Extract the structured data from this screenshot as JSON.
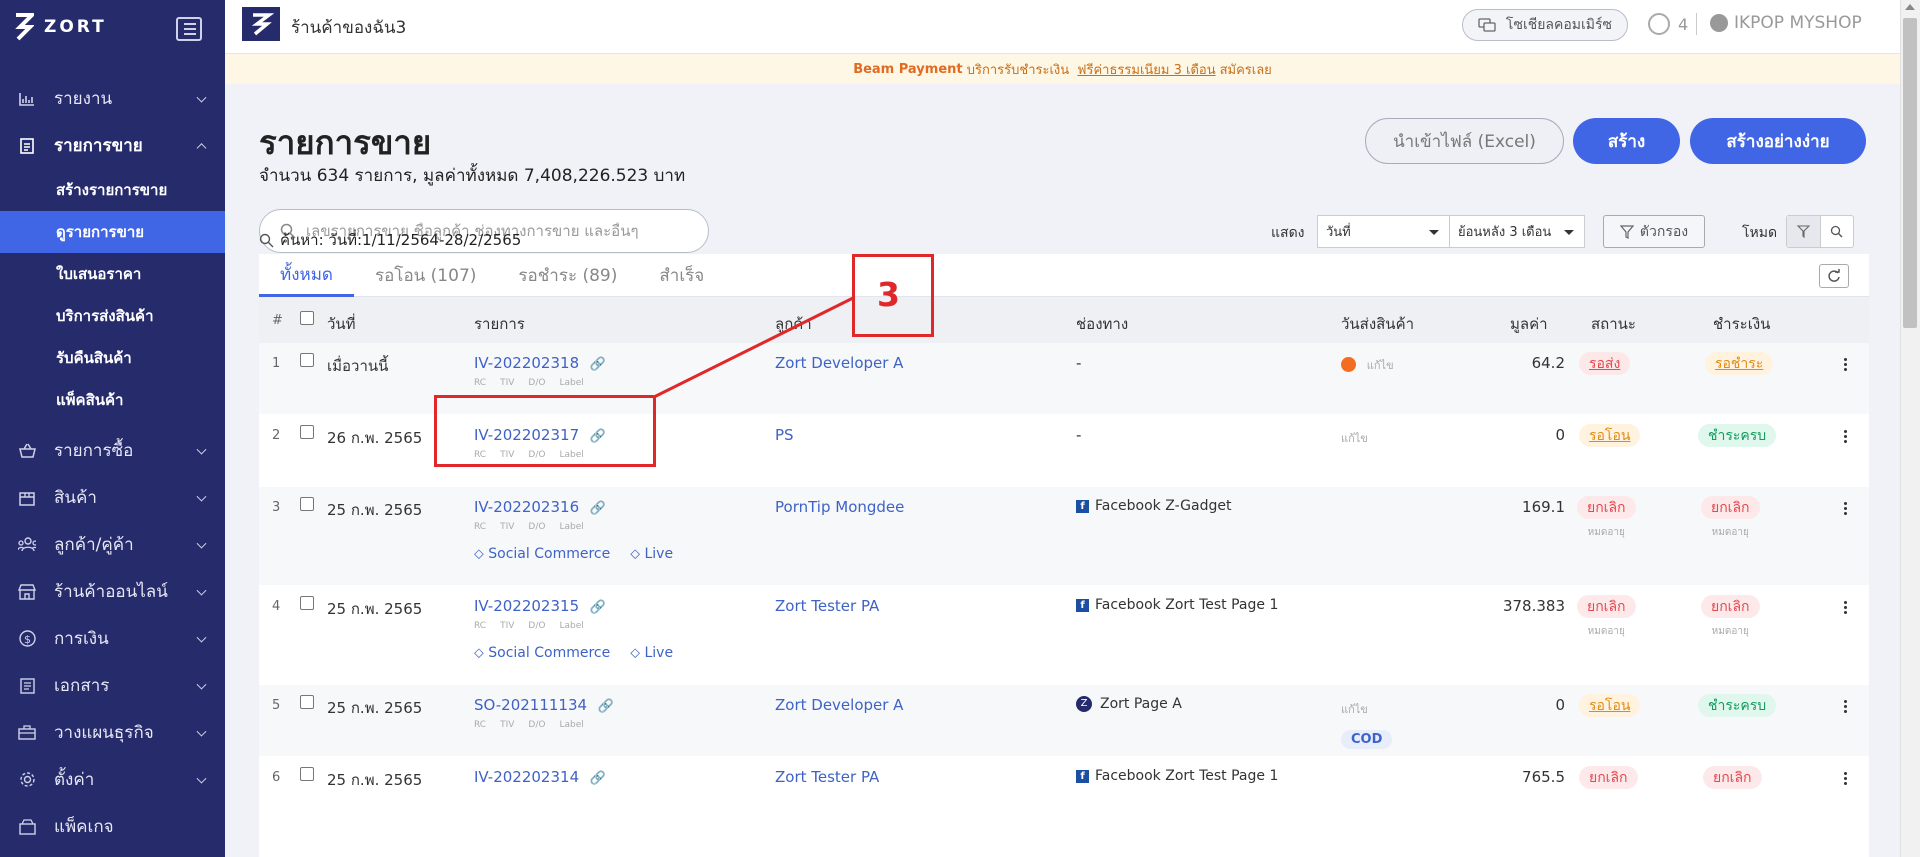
{
  "app": {
    "name": "ZORT",
    "store_name": "ร้านค้าของฉัน3",
    "social_btn": "โซเชียลคอมเมิร์ซ",
    "help_count": "4",
    "user": "IKPOP MYSHOP"
  },
  "sidebar": {
    "items": [
      {
        "label": "รายงาน",
        "icon": "chart-icon"
      },
      {
        "label": "รายการขาย",
        "icon": "clipboard-icon"
      },
      {
        "label": "รายการซื้อ",
        "icon": "basket-icon"
      },
      {
        "label": "สินค้า",
        "icon": "box-icon"
      },
      {
        "label": "ลูกค้า/คู่ค้า",
        "icon": "people-icon"
      },
      {
        "label": "ร้านค้าออนไลน์",
        "icon": "store-icon"
      },
      {
        "label": "การเงิน",
        "icon": "dollar-icon"
      },
      {
        "label": "เอกสาร",
        "icon": "document-icon"
      },
      {
        "label": "วางแผนธุรกิจ",
        "icon": "briefcase-icon"
      },
      {
        "label": "ตั้งค่า",
        "icon": "gear-icon"
      },
      {
        "label": "แพ็คเกจ",
        "icon": "package-icon"
      }
    ],
    "sub_items": [
      "สร้างรายการขาย",
      "ดูรายการขาย",
      "ใบเสนอราคา",
      "บริการส่งสินค้า",
      "รับคืนสินค้า",
      "แพ็คสินค้า"
    ]
  },
  "banner": {
    "brand": "Beam Payment",
    "text1": "บริการรับชำระเงิน",
    "promo": "ฟรีค่าธรรมเนียม 3 เดือน",
    "cta": "สมัครเลย"
  },
  "page": {
    "title": "รายการขาย",
    "summary": "จำนวน 634 รายการ, มูลค่าทั้งหมด 7,408,226.523 บาท",
    "import_btn": "นำเข้าไฟล์ (Excel)",
    "create_btn": "สร้าง",
    "easy_create_btn": "สร้างอย่างง่าย",
    "search_placeholder": "เลขรายการขาย ชื่อลูกค้า ช่องทางการขาย และอื่นๆ",
    "show_label": "แสดง",
    "date_select": "วันที่",
    "range_select": "ย้อนหลัง 3 เดือน",
    "filter_btn": "ตัวกรอง",
    "mode_label": "โหมด",
    "query": "ค้นหา: วันที่:1/11/2564-28/2/2565"
  },
  "tabs": [
    "ทั้งหมด",
    "รอโอน (107)",
    "รอชำระ (89)",
    "สำเร็จ"
  ],
  "table": {
    "headers": [
      "#",
      "วันที่",
      "รายการ",
      "ลูกค้า",
      "ช่องทาง",
      "วันส่งสินค้า",
      "มูลค่า",
      "สถานะ",
      "ชำระเงิน"
    ],
    "pill_labels": [
      "RC",
      "TIV",
      "D/O",
      "Label"
    ],
    "tag_social": "Social Commerce",
    "tag_live": "Live",
    "edit_label": "แก้ไข",
    "rows": [
      {
        "n": "1",
        "date": "เมื่อวานนี้",
        "id": "IV-202202318",
        "customer": "Zort Developer A",
        "channel": "-",
        "value": "64.2",
        "status": "รอส่ง",
        "payment": "รอชำระ"
      },
      {
        "n": "2",
        "date": "26 ก.พ. 2565",
        "id": "IV-202202317",
        "customer": "PS",
        "channel": "-",
        "value": "0",
        "status": "รอโอน",
        "payment": "ชำระครบ"
      },
      {
        "n": "3",
        "date": "25 ก.พ. 2565",
        "id": "IV-202202316",
        "customer": "PornTip Mongdee",
        "channel": "Facebook Z-Gadget",
        "value": "169.1",
        "status": "ยกเลิก",
        "payment": "ยกเลิก",
        "note": "หมดอายุ"
      },
      {
        "n": "4",
        "date": "25 ก.พ. 2565",
        "id": "IV-202202315",
        "customer": "Zort Tester PA",
        "channel": "Facebook Zort Test Page 1",
        "value": "378.383",
        "status": "ยกเลิก",
        "payment": "ยกเลิก",
        "note": "หมดอายุ"
      },
      {
        "n": "5",
        "date": "25 ก.พ. 2565",
        "id": "SO-202111134",
        "customer": "Zort Developer A",
        "channel": "Zort Page A",
        "value": "0",
        "status": "รอโอน",
        "payment": "ชำระครบ",
        "cod": "COD"
      },
      {
        "n": "6",
        "date": "25 ก.พ. 2565",
        "id": "IV-202202314",
        "customer": "Zort Tester PA",
        "channel": "Facebook Zort Test Page 1",
        "value": "765.5",
        "status": "ยกเลิก",
        "payment": "ยกเลิก"
      }
    ]
  },
  "annotation": {
    "label": "3",
    "color": "#e0282a"
  },
  "colors": {
    "sidebar": "#262b6b",
    "accent": "#4166e5"
  }
}
